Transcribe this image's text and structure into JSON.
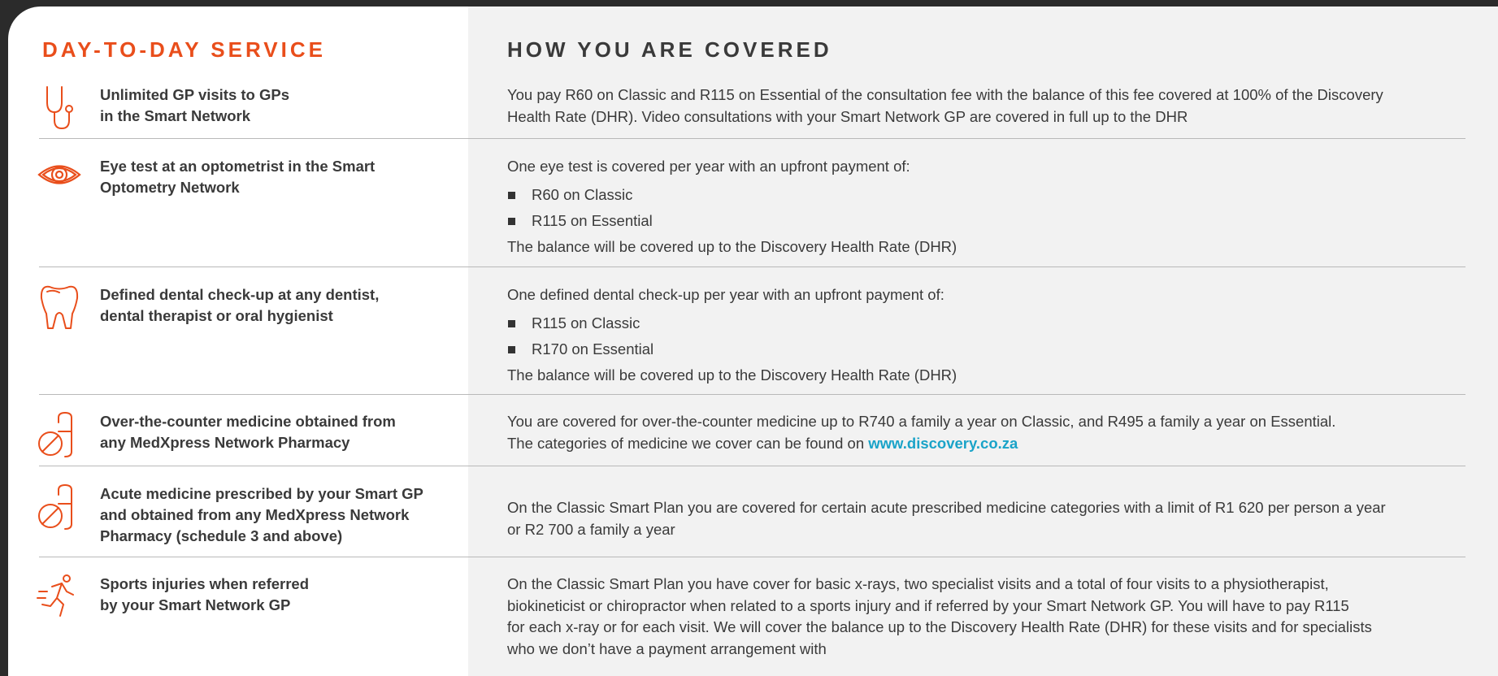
{
  "headings": {
    "service": "DAY-TO-DAY SERVICE",
    "cover": "HOW YOU ARE COVERED"
  },
  "rows": [
    {
      "icon": "stethoscope-icon",
      "title_1": "Unlimited GP visits to GPs",
      "title_2": "in the Smart Network",
      "desc_1": "You pay R60 on Classic and R115 on Essential of the consultation fee with the balance of this fee covered at 100% of the Discovery",
      "desc_2": "Health Rate (DHR). Video consultations with your Smart Network GP are covered in full up to the DHR"
    },
    {
      "icon": "eye-icon",
      "title_1": "Eye test at an optometrist in the Smart",
      "title_2": "Optometry Network",
      "intro": "One eye test is covered per year with an upfront payment of:",
      "bullets": [
        "R60 on Classic",
        "R115 on Essential"
      ],
      "outro": "The balance will be covered up to the Discovery Health Rate (DHR)"
    },
    {
      "icon": "tooth-icon",
      "title_1": "Defined dental check-up at any dentist,",
      "title_2": "dental therapist or oral hygienist",
      "intro": "One defined dental check-up per year with an upfront payment of:",
      "bullets": [
        "R115 on Classic",
        "R170 on Essential"
      ],
      "outro": "The balance will be covered up to the Discovery Health Rate (DHR)"
    },
    {
      "icon": "medicine-icon",
      "title_1": "Over-the-counter medicine obtained from",
      "title_2": "any MedXpress Network Pharmacy",
      "desc_1": "You are covered for over-the-counter medicine up to R740 a family a year on Classic, and R495 a family a year on Essential.",
      "desc_2": "The categories of medicine we cover can be found on ",
      "link": "www.discovery.co.za"
    },
    {
      "icon": "medicine-icon",
      "title_1": "Acute medicine prescribed by your Smart GP",
      "title_2": "and obtained from any MedXpress Network",
      "title_3": "Pharmacy (schedule 3 and above)",
      "desc_1": "On the Classic Smart Plan you are covered for certain acute prescribed medicine categories with a limit of R1 620 per person a year",
      "desc_2": "or R2 700 a family a year"
    },
    {
      "icon": "runner-icon",
      "title_1": "Sports injuries when referred",
      "title_2": "by your Smart Network GP",
      "desc_1": "On the Classic Smart Plan you have cover for basic x-rays, two specialist visits and a total of four visits to a physiotherapist,",
      "desc_2": "biokineticist or chiropractor when related to a sports injury and if referred by your Smart Network GP. You will have to pay R115",
      "desc_3": "for each x-ray or for each visit. We will cover the balance up to the Discovery Health Rate (DHR) for these visits and for specialists",
      "desc_4": "who we don’t have a payment arrangement with"
    }
  ],
  "colors": {
    "accent": "#e94e1b",
    "link": "#1aa3c8",
    "panel": "#f2f2f2",
    "background": "#2b2b2b"
  }
}
